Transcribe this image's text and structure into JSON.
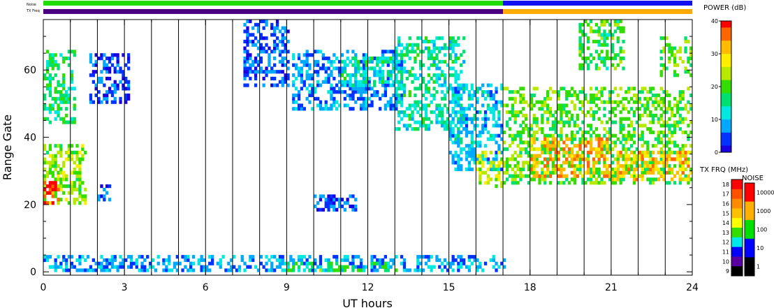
{
  "chart_data": {
    "type": "heatmap",
    "xlabel": "UT hours",
    "ylabel": "Range Gate",
    "xlim": [
      0,
      24
    ],
    "ylim": [
      -1,
      75
    ],
    "x_ticks": [
      0,
      3,
      6,
      9,
      12,
      15,
      18,
      21,
      24
    ],
    "y_ticks": [
      0,
      20,
      40,
      60
    ],
    "noise_label": "Noise",
    "txfreq_label": "TX Freq",
    "power_scale": {
      "label": "POWER (dB)",
      "min": 0,
      "max": 40,
      "ticks": [
        0,
        10,
        20,
        30,
        40
      ],
      "colors": [
        "#1a00e0",
        "#0033ff",
        "#00a8ff",
        "#00e8e0",
        "#00e070",
        "#33dd00",
        "#b8e800",
        "#ffee00",
        "#ffbb00",
        "#ff6600",
        "#ff0000"
      ]
    },
    "txfreq_scale": {
      "label": "TX FRQ (MHz)",
      "ticks": [
        "18",
        "17",
        "16",
        "15",
        "14",
        "13",
        "12",
        "11",
        "10",
        "9"
      ],
      "colors": [
        "#ff0000",
        "#ff5000",
        "#ff8c00",
        "#ffc000",
        "#ffff00",
        "#33dd00",
        "#00e8e8",
        "#0000ff",
        "#5a00a0",
        "#000000"
      ]
    },
    "noise_scale": {
      "label": "NOISE",
      "ticks": [
        "10000",
        "1000",
        "100",
        "10",
        "1"
      ],
      "colors": [
        "#ff0000",
        "#ffb000",
        "#00e000",
        "#0000ff",
        "#000000"
      ]
    },
    "noise_strip": [
      {
        "from": 0,
        "to": 17,
        "color": "#22dd00"
      },
      {
        "from": 17,
        "to": 24,
        "color": "#1010f0"
      }
    ],
    "txfreq_strip": [
      {
        "from": 0,
        "to": 17,
        "color": "#4b0082"
      },
      {
        "from": 17,
        "to": 24,
        "color": "#ffaa00"
      }
    ],
    "echo_regions": [
      {
        "x": [
          0.0,
          1.6
        ],
        "gate": [
          20,
          38
        ],
        "power": 22
      },
      {
        "x": [
          0.0,
          0.6
        ],
        "gate": [
          20,
          27
        ],
        "power": 37
      },
      {
        "x": [
          0.0,
          1.2
        ],
        "gate": [
          44,
          66
        ],
        "power": 16
      },
      {
        "x": [
          1.7,
          3.2
        ],
        "gate": [
          50,
          65
        ],
        "power": 4
      },
      {
        "x": [
          7.4,
          9.0
        ],
        "gate": [
          55,
          75
        ],
        "power": 5
      },
      {
        "x": [
          9.2,
          13.2
        ],
        "gate": [
          48,
          66
        ],
        "power": 7
      },
      {
        "x": [
          11.0,
          13.0
        ],
        "gate": [
          55,
          64
        ],
        "power": 14
      },
      {
        "x": [
          13.0,
          15.5
        ],
        "gate": [
          42,
          70
        ],
        "power": 14
      },
      {
        "x": [
          15.0,
          17.0
        ],
        "gate": [
          30,
          56
        ],
        "power": 10
      },
      {
        "x": [
          16.0,
          17.0
        ],
        "gate": [
          25,
          36
        ],
        "power": 25
      },
      {
        "x": [
          17.0,
          24.0
        ],
        "gate": [
          26,
          55
        ],
        "power": 20
      },
      {
        "x": [
          18.0,
          21.0
        ],
        "gate": [
          28,
          40
        ],
        "power": 33
      },
      {
        "x": [
          21.0,
          24.0
        ],
        "gate": [
          27,
          36
        ],
        "power": 31
      },
      {
        "x": [
          19.8,
          21.5
        ],
        "gate": [
          60,
          75
        ],
        "power": 18
      },
      {
        "x": [
          22.8,
          24.0
        ],
        "gate": [
          58,
          70
        ],
        "power": 20
      },
      {
        "x": [
          2.0,
          2.5
        ],
        "gate": [
          21,
          26
        ],
        "power": 6
      },
      {
        "x": [
          10.0,
          11.5
        ],
        "gate": [
          18,
          23
        ],
        "power": 5
      },
      {
        "x": [
          0.0,
          17.0
        ],
        "gate": [
          0,
          5
        ],
        "power": 8
      },
      {
        "x": [
          9.0,
          13.0
        ],
        "gate": [
          0,
          3
        ],
        "power": 18
      }
    ]
  }
}
